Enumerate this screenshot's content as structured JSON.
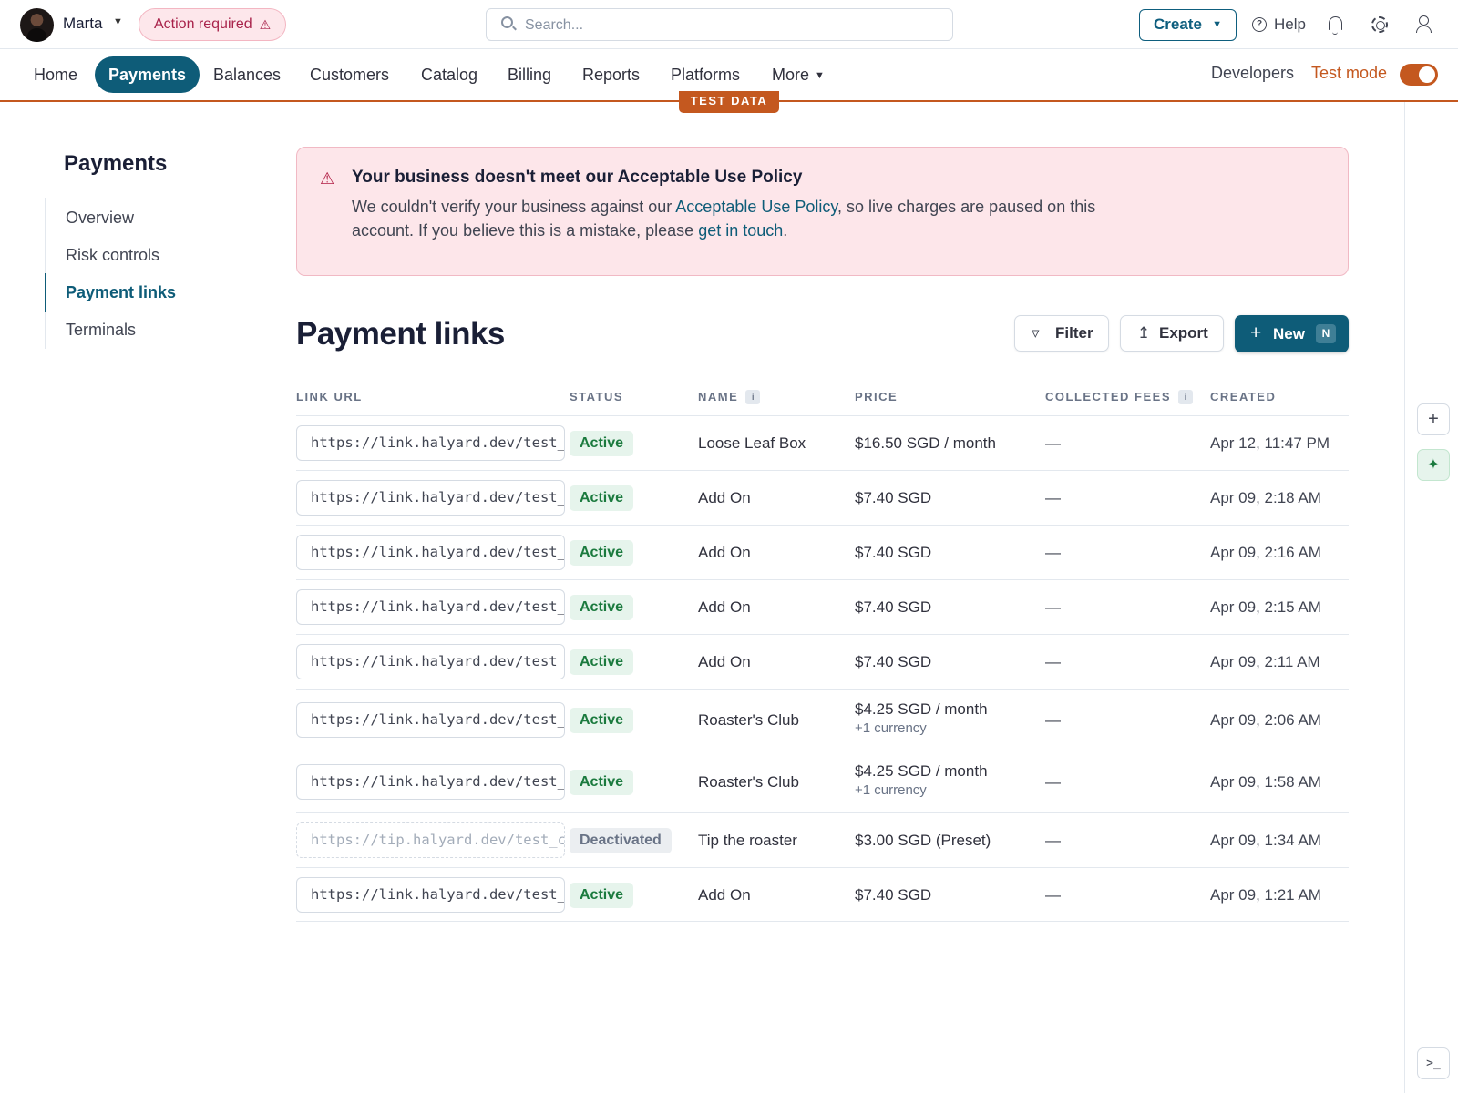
{
  "topbar": {
    "account_name": "Marta",
    "action_required": "Action required",
    "search_placeholder": "Search...",
    "create_label": "Create",
    "help_label": "Help"
  },
  "nav": {
    "items": [
      "Home",
      "Payments",
      "Balances",
      "Customers",
      "Catalog",
      "Billing",
      "Reports",
      "Platforms",
      "More"
    ],
    "active": "Payments",
    "developers": "Developers",
    "test_mode": "Test mode",
    "test_mode_on": true,
    "test_data_tag": "TEST DATA"
  },
  "sidebar": {
    "title": "Payments",
    "items": [
      "Overview",
      "Risk controls",
      "Payment links",
      "Terminals"
    ],
    "active": "Payment links"
  },
  "alert": {
    "title": "Your business doesn't meet our Acceptable Use Policy",
    "body_1": "We couldn't verify your business against our ",
    "link_1": "Acceptable Use Policy",
    "body_2": ", so live charges are paused on this account. If you believe this is a mistake, please ",
    "link_2": "get in touch",
    "body_3": "."
  },
  "page": {
    "title": "Payment links",
    "filter_label": "Filter",
    "export_label": "Export",
    "new_label": "New",
    "new_shortcut": "N"
  },
  "table": {
    "columns": [
      "LINK URL",
      "STATUS",
      "NAME",
      "PRICE",
      "COLLECTED FEES",
      "CREATED"
    ],
    "rows": [
      {
        "url": "https://link.halyard.dev/test_",
        "status": "Active",
        "name": "Loose Leaf Box",
        "price": "$16.50 SGD / month",
        "price_sub": "",
        "fees": "—",
        "created": "Apr 12, 11:47 PM"
      },
      {
        "url": "https://link.halyard.dev/test_",
        "status": "Active",
        "name": "Add On",
        "price": "$7.40 SGD",
        "price_sub": "",
        "fees": "—",
        "created": "Apr 09, 2:18 AM"
      },
      {
        "url": "https://link.halyard.dev/test_",
        "status": "Active",
        "name": "Add On",
        "price": "$7.40 SGD",
        "price_sub": "",
        "fees": "—",
        "created": "Apr 09, 2:16 AM"
      },
      {
        "url": "https://link.halyard.dev/test_",
        "status": "Active",
        "name": "Add On",
        "price": "$7.40 SGD",
        "price_sub": "",
        "fees": "—",
        "created": "Apr 09, 2:15 AM"
      },
      {
        "url": "https://link.halyard.dev/test_",
        "status": "Active",
        "name": "Add On",
        "price": "$7.40 SGD",
        "price_sub": "",
        "fees": "—",
        "created": "Apr 09, 2:11 AM"
      },
      {
        "url": "https://link.halyard.dev/test_",
        "status": "Active",
        "name": "Roaster's Club",
        "price": "$4.25 SGD / month",
        "price_sub": "+1 currency",
        "fees": "—",
        "created": "Apr 09, 2:06 AM"
      },
      {
        "url": "https://link.halyard.dev/test_",
        "status": "Active",
        "name": "Roaster's Club",
        "price": "$4.25 SGD / month",
        "price_sub": "+1 currency",
        "fees": "—",
        "created": "Apr 09, 1:58 AM"
      },
      {
        "url": "https://tip.halyard.dev/test_c",
        "status": "Deactivated",
        "name": "Tip the roaster",
        "price": "$3.00 SGD (Preset)",
        "price_sub": "",
        "fees": "—",
        "created": "Apr 09, 1:34 AM"
      },
      {
        "url": "https://link.halyard.dev/test_",
        "status": "Active",
        "name": "Add On",
        "price": "$7.40 SGD",
        "price_sub": "",
        "fees": "—",
        "created": "Apr 09, 1:21 AM"
      }
    ]
  },
  "colors": {
    "primary": "#0e5c78",
    "test_mode": "#c4581f",
    "alert_bg": "#fde6ea",
    "active_badge": "#e6f4ec"
  },
  "icons": [
    "avatar",
    "chevron-down-icon",
    "warning-icon",
    "search-icon",
    "help-icon",
    "bell-icon",
    "gear-icon",
    "user-icon",
    "filter-icon",
    "export-icon",
    "plus-icon",
    "info-icon",
    "sparkle-icon",
    "terminal-icon"
  ]
}
